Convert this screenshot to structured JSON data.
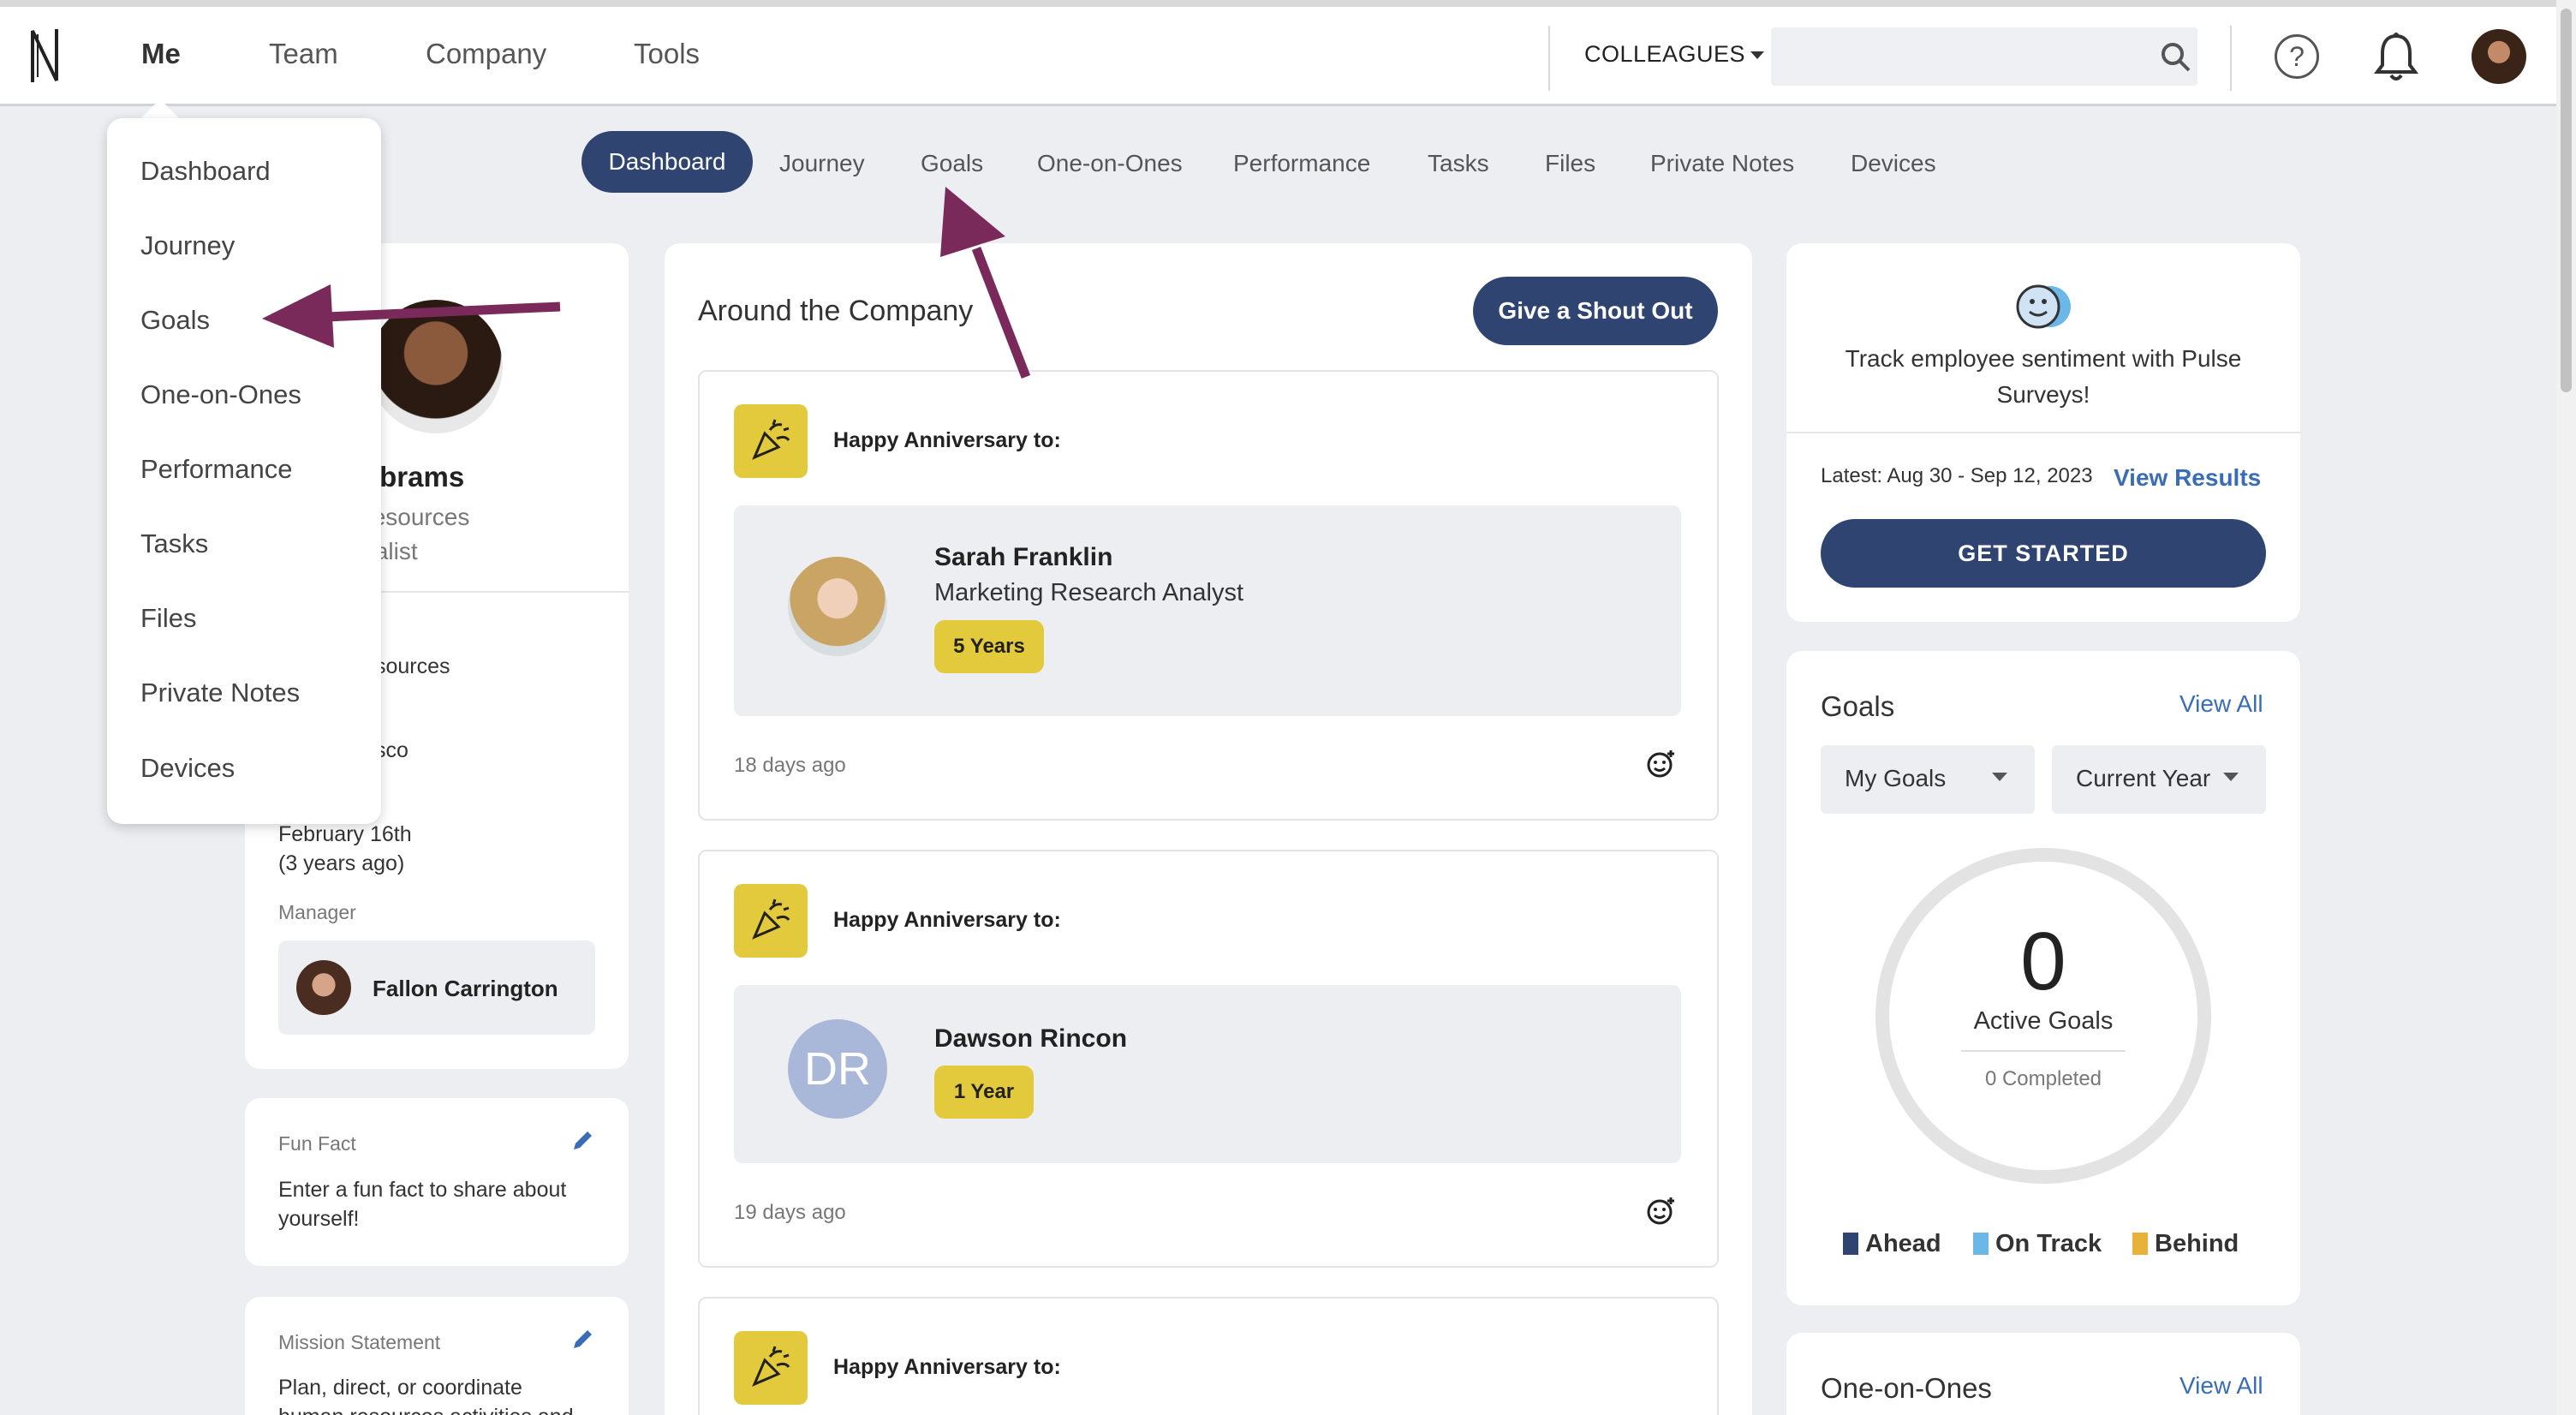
{
  "topnav": {
    "items": [
      "Me",
      "Team",
      "Company",
      "Tools"
    ],
    "colleagues_label": "COLLEAGUES",
    "search_placeholder": "",
    "help_glyph": "?"
  },
  "subtabs": {
    "active": "Dashboard",
    "items": [
      "Journey",
      "Goals",
      "One-on-Ones",
      "Performance",
      "Tasks",
      "Files",
      "Private Notes",
      "Devices"
    ]
  },
  "me_menu": {
    "items": [
      "Dashboard",
      "Journey",
      "Goals",
      "One-on-Ones",
      "Performance",
      "Tasks",
      "Files",
      "Private Notes",
      "Devices"
    ]
  },
  "profile": {
    "name_visible": "rah Abrams",
    "title_line1": "nan Resources",
    "title_line2": "Generalist",
    "dept_label_fragment": "t",
    "dept_value_fragment": "sources",
    "location_value_fragment": "sco",
    "start_date": "February 16th",
    "start_relative": "(3 years ago)",
    "manager_label": "Manager",
    "manager_name": "Fallon Carrington"
  },
  "fun_fact": {
    "label": "Fun Fact",
    "text": "Enter a fun fact to share about yourself!"
  },
  "mission": {
    "label": "Mission Statement",
    "text_line1": "Plan, direct, or coordinate",
    "text_line2": "human resources activities and"
  },
  "feed": {
    "title": "Around the Company",
    "shout_button": "Give a Shout Out",
    "cards": [
      {
        "heading": "Happy Anniversary to:",
        "name": "Sarah Franklin",
        "role": "Marketing Research Analyst",
        "badge": "5 Years",
        "time": "18 days ago"
      },
      {
        "heading": "Happy Anniversary to:",
        "name": "Dawson Rincon",
        "initials": "DR",
        "badge": "1 Year",
        "time": "19 days ago"
      },
      {
        "heading": "Happy Anniversary to:"
      }
    ]
  },
  "pulse": {
    "text_line1": "Track employee sentiment with Pulse",
    "text_line2": "Surveys!",
    "latest": "Latest: Aug 30 - Sep 12, 2023",
    "view_results": "View Results",
    "get_started": "GET STARTED"
  },
  "goals": {
    "title": "Goals",
    "view_all": "View All",
    "filter1": "My Goals",
    "filter2": "Current Year",
    "count": "0",
    "active_label": "Active Goals",
    "completed": "0 Completed",
    "legend": [
      {
        "label": "Ahead",
        "color": "#2f4470"
      },
      {
        "label": "On Track",
        "color": "#6ab7e8"
      },
      {
        "label": "Behind",
        "color": "#e8b23a"
      }
    ]
  },
  "one_on_ones": {
    "title": "One-on-Ones",
    "view_all": "View All"
  },
  "colors": {
    "navy": "#2f4470",
    "annotation_arrow": "#7a2a5a",
    "badge_yellow": "#e3c93c"
  }
}
